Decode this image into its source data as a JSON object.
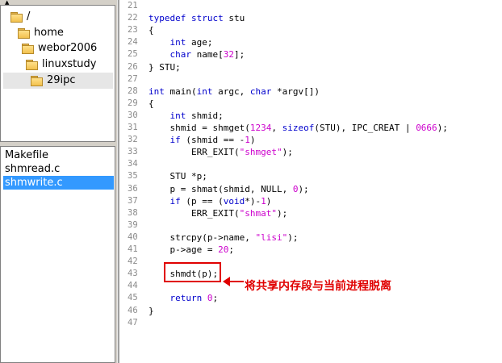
{
  "dir_tree": {
    "items": [
      {
        "label": "/"
      },
      {
        "label": "home"
      },
      {
        "label": "webor2006"
      },
      {
        "label": "linuxstudy"
      },
      {
        "label": "29ipc",
        "selected": true
      }
    ]
  },
  "file_list": {
    "items": [
      {
        "label": "Makefile"
      },
      {
        "label": "shmread.c"
      },
      {
        "label": "shmwrite.c",
        "selected": true
      }
    ]
  },
  "editor": {
    "line_numbers": [
      "21",
      "22",
      "23",
      "24",
      "25",
      "26",
      "27",
      "28",
      "29",
      "30",
      "31",
      "32",
      "33",
      "34",
      "35",
      "36",
      "37",
      "38",
      "39",
      "40",
      "41",
      "42",
      "43",
      "44",
      "45",
      "46",
      "47"
    ],
    "lines": [
      [],
      [
        {
          "t": "typedef struct",
          "k": "kw"
        },
        {
          "t": " stu"
        }
      ],
      [
        {
          "t": "{"
        }
      ],
      [
        {
          "t": "    "
        },
        {
          "t": "int",
          "k": "kw"
        },
        {
          "t": " age;"
        }
      ],
      [
        {
          "t": "    "
        },
        {
          "t": "char",
          "k": "kw"
        },
        {
          "t": " name["
        },
        {
          "t": "32",
          "k": "num"
        },
        {
          "t": "];"
        }
      ],
      [
        {
          "t": "} STU;"
        }
      ],
      [],
      [
        {
          "t": "int",
          "k": "kw"
        },
        {
          "t": " main("
        },
        {
          "t": "int",
          "k": "kw"
        },
        {
          "t": " argc, "
        },
        {
          "t": "char",
          "k": "kw"
        },
        {
          "t": " *argv[])"
        }
      ],
      [
        {
          "t": "{"
        }
      ],
      [
        {
          "t": "    "
        },
        {
          "t": "int",
          "k": "kw"
        },
        {
          "t": " shmid;"
        }
      ],
      [
        {
          "t": "    shmid = shmget("
        },
        {
          "t": "1234",
          "k": "num"
        },
        {
          "t": ", "
        },
        {
          "t": "sizeof",
          "k": "kw"
        },
        {
          "t": "(STU), IPC_CREAT | "
        },
        {
          "t": "0666",
          "k": "num"
        },
        {
          "t": ");"
        }
      ],
      [
        {
          "t": "    "
        },
        {
          "t": "if",
          "k": "kw"
        },
        {
          "t": " (shmid == -"
        },
        {
          "t": "1",
          "k": "num"
        },
        {
          "t": ")"
        }
      ],
      [
        {
          "t": "        ERR_EXIT("
        },
        {
          "t": "\"shmget\"",
          "k": "str"
        },
        {
          "t": ");"
        }
      ],
      [],
      [
        {
          "t": "    STU *p;"
        }
      ],
      [
        {
          "t": "    p = shmat(shmid, NULL, "
        },
        {
          "t": "0",
          "k": "num"
        },
        {
          "t": ");"
        }
      ],
      [
        {
          "t": "    "
        },
        {
          "t": "if",
          "k": "kw"
        },
        {
          "t": " (p == ("
        },
        {
          "t": "void",
          "k": "kw"
        },
        {
          "t": "*)-"
        },
        {
          "t": "1",
          "k": "num"
        },
        {
          "t": ")"
        }
      ],
      [
        {
          "t": "        ERR_EXIT("
        },
        {
          "t": "\"shmat\"",
          "k": "str"
        },
        {
          "t": ");"
        }
      ],
      [],
      [
        {
          "t": "    strcpy(p->name, "
        },
        {
          "t": "\"lisi\"",
          "k": "str"
        },
        {
          "t": ");"
        }
      ],
      [
        {
          "t": "    p->age = "
        },
        {
          "t": "20",
          "k": "num"
        },
        {
          "t": ";"
        }
      ],
      [],
      [
        {
          "t": "    shmdt(p);"
        }
      ],
      [],
      [
        {
          "t": "    "
        },
        {
          "t": "return",
          "k": "kw"
        },
        {
          "t": " "
        },
        {
          "t": "0",
          "k": "num"
        },
        {
          "t": ";"
        }
      ],
      [
        {
          "t": "}"
        }
      ],
      []
    ]
  },
  "annotation": {
    "text": "将共享内存段与当前进程脱离",
    "color": "#e00000"
  },
  "colors": {
    "keyword": "#0000cc",
    "literal": "#cc00cc",
    "selection": "#3399ff"
  }
}
